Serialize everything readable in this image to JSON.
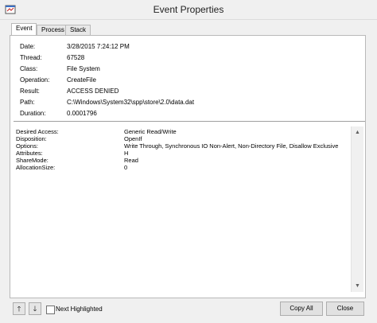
{
  "window": {
    "title": "Event Properties"
  },
  "tabs": [
    {
      "label": "Event",
      "active": true
    },
    {
      "label": "Process",
      "active": false
    },
    {
      "label": "Stack",
      "active": false
    }
  ],
  "event_fields": [
    {
      "label": "Date:",
      "value": "3/28/2015 7:24:12 PM"
    },
    {
      "label": "Thread:",
      "value": "67528"
    },
    {
      "label": "Class:",
      "value": "File System"
    },
    {
      "label": "Operation:",
      "value": "CreateFile"
    },
    {
      "label": "Result:",
      "value": "ACCESS DENIED"
    },
    {
      "label": "Path:",
      "value": "C:\\Windows\\System32\\spp\\store\\2.0\\data.dat"
    },
    {
      "label": "Duration:",
      "value": "0.0001796"
    }
  ],
  "details": [
    {
      "label": "Desired Access:",
      "value": "Generic Read/Write"
    },
    {
      "label": "Disposition:",
      "value": "OpenIf"
    },
    {
      "label": "Options:",
      "value": "Write Through, Synchronous IO Non-Alert, Non-Directory File, Disallow Exclusive"
    },
    {
      "label": "Attributes:",
      "value": "H"
    },
    {
      "label": "ShareMode:",
      "value": "Read"
    },
    {
      "label": "AllocationSize:",
      "value": "0"
    }
  ],
  "footer": {
    "next_highlighted_label": "Next Highlighted",
    "next_highlighted_checked": false,
    "copy_all_label": "Copy All",
    "close_label": "Close"
  },
  "icons": {
    "up": "arrow-up-icon",
    "down": "arrow-down-icon"
  }
}
